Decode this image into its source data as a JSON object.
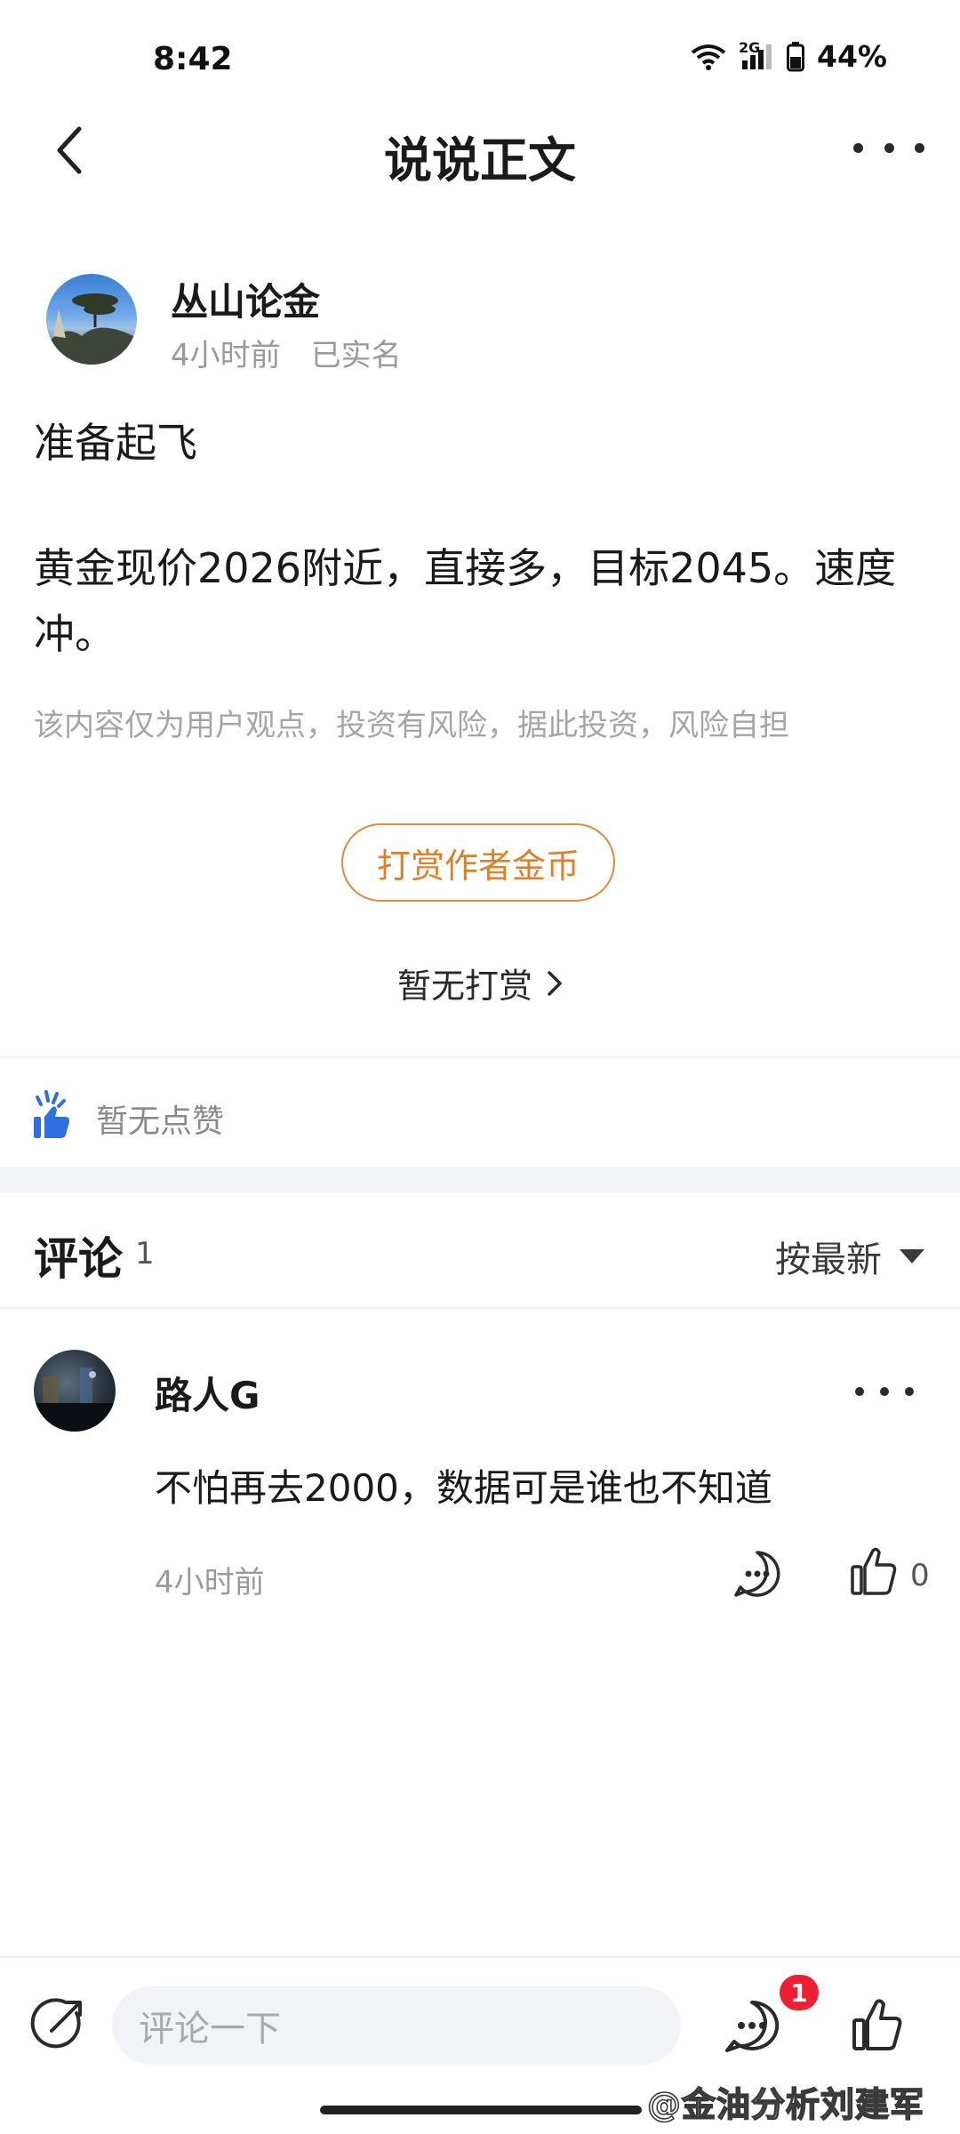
{
  "status_bar": {
    "time": "8:42",
    "network": "2G",
    "battery": "44%"
  },
  "header": {
    "title": "说说正文",
    "back_icon": "chevron-left-icon",
    "more_icon": "more-horizontal-icon"
  },
  "post": {
    "author_name": "丛山论金",
    "time": "4小时前",
    "verified": "已实名",
    "title": "准备起飞",
    "body": "黄金现价2026附近，直接多，目标2045。速度冲。",
    "disclaimer": "该内容仅为用户观点，投资有风险，据此投资，风险自担"
  },
  "tip": {
    "button_label": "打赏作者金币",
    "status": "暂无打赏",
    "accent": "#e07f2a"
  },
  "likes": {
    "label": "暂无点赞",
    "icon_color": "#2f6fe0"
  },
  "comments": {
    "title": "评论",
    "count": "1",
    "sort_label": "按最新",
    "items": [
      {
        "user": "路人G",
        "text": "不怕再去2000，数据可是谁也不知道",
        "time": "4小时前",
        "likes": "0"
      }
    ]
  },
  "bottom_bar": {
    "input_placeholder": "评论一下",
    "comment_badge": "1",
    "badge_color": "#f01e32"
  },
  "watermark": "@金油分析刘建军"
}
